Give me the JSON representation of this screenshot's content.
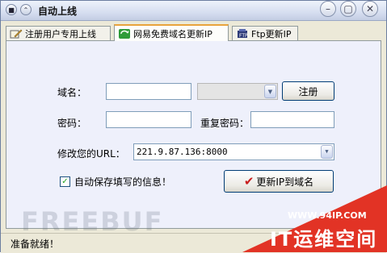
{
  "window": {
    "title": "自动上线"
  },
  "tabs": [
    {
      "label": "注册用户专用上线"
    },
    {
      "label": "网易免费域名更新IP"
    },
    {
      "label": "Ftp更新IP"
    }
  ],
  "form": {
    "domain_label": "域名：",
    "domain_value": "",
    "domain_suffix_value": "",
    "register_button": "注册",
    "password_label": "密码：",
    "password_value": "",
    "repeat_password_label": "重复密码：",
    "repeat_password_value": "",
    "url_label": "修改您的URL：",
    "url_value": "221.9.87.136:8000",
    "autosave_label": "自动保存填写的信息！",
    "autosave_checked": true,
    "update_button": "更新IP到域名"
  },
  "status": {
    "text": "准备就绪！"
  },
  "overlay": {
    "watermark": "FREEBUF",
    "promo_url": "WWW.94IP.COM",
    "promo_name": "IT运维空间",
    "promo_color": "#e23325"
  }
}
